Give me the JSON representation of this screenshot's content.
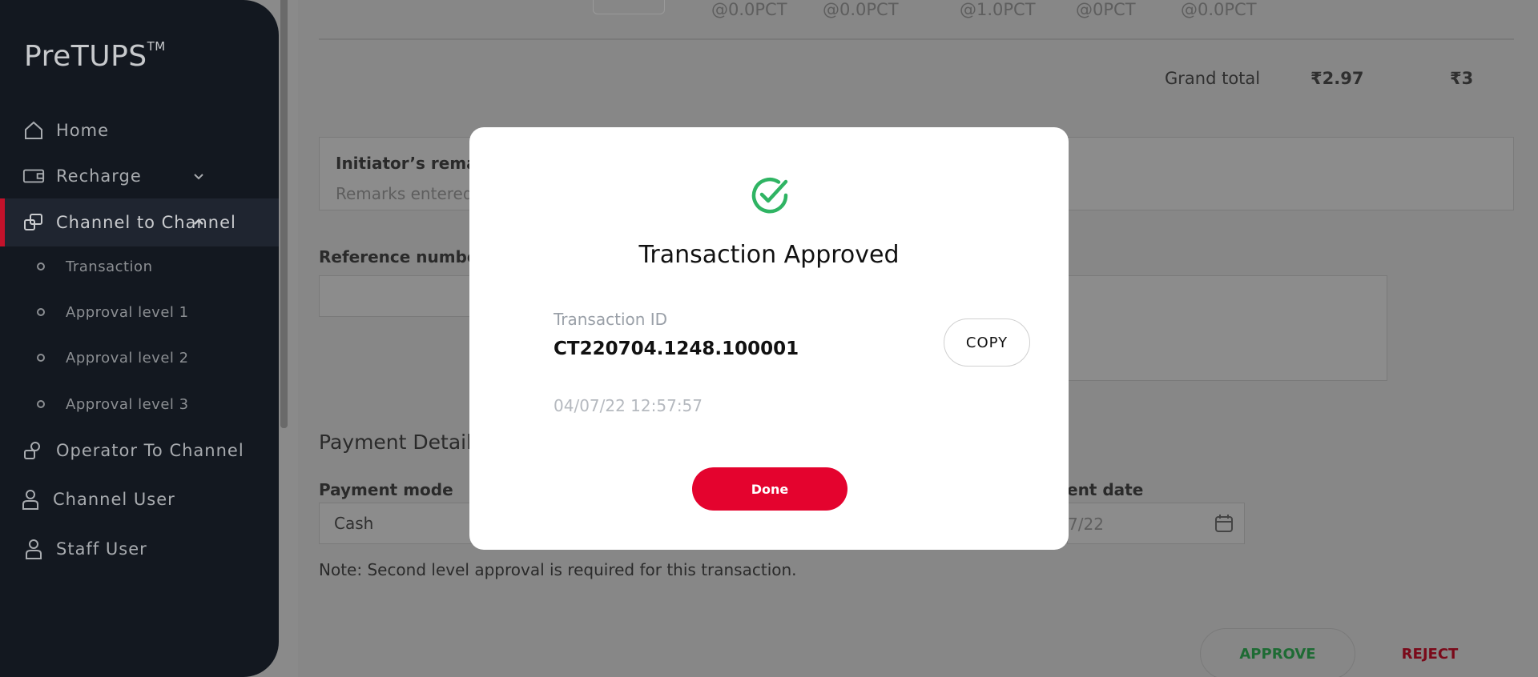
{
  "app": {
    "logo": "PreTUPS",
    "logo_tm": "TM"
  },
  "sidebar": {
    "items": [
      {
        "label": "Home",
        "icon": "home-icon"
      },
      {
        "label": "Recharge",
        "icon": "recharge-icon"
      },
      {
        "label": "Channel to Channel",
        "icon": "channel-icon",
        "active": true
      },
      {
        "label": "Operator To Channel",
        "icon": "operator-icon"
      },
      {
        "label": "Channel User",
        "icon": "user-icon"
      },
      {
        "label": "Staff User",
        "icon": "staff-icon"
      }
    ],
    "subitems": [
      {
        "label": "Transaction"
      },
      {
        "label": "Approval level 1"
      },
      {
        "label": "Approval level 2"
      },
      {
        "label": "Approval level 3"
      }
    ]
  },
  "main": {
    "tax_row": [
      "@0.0PCT",
      "@0.0PCT",
      "@1.0PCT",
      "@0PCT",
      "@0.0PCT"
    ],
    "grand_total_label": "Grand total",
    "grand_total_value1": "₹2.97",
    "grand_total_value2": "₹3",
    "remarks_title": "Initiator’s remark",
    "remarks_text": "Remarks entered",
    "reference_label": "Reference number",
    "payment_title": "Payment Details",
    "payment_mode_label": "Payment mode",
    "payment_mode_value": "Cash",
    "payment_date_label": "ent date",
    "payment_date_value": "7/22",
    "note": "Note: Second level approval is required for this transaction.",
    "approve_label": "APPROVE",
    "reject_label": "REJECT"
  },
  "modal": {
    "title": "Transaction Approved",
    "transaction_id_label": "Transaction ID",
    "transaction_id": "CT220704.1248.100001",
    "timestamp": "04/07/22 12:57:57",
    "copy_label": "COPY",
    "done_label": "Done"
  },
  "colors": {
    "sidebar_bg": "#131820",
    "accent_red": "#e4032e",
    "success_green": "#2fb463"
  }
}
